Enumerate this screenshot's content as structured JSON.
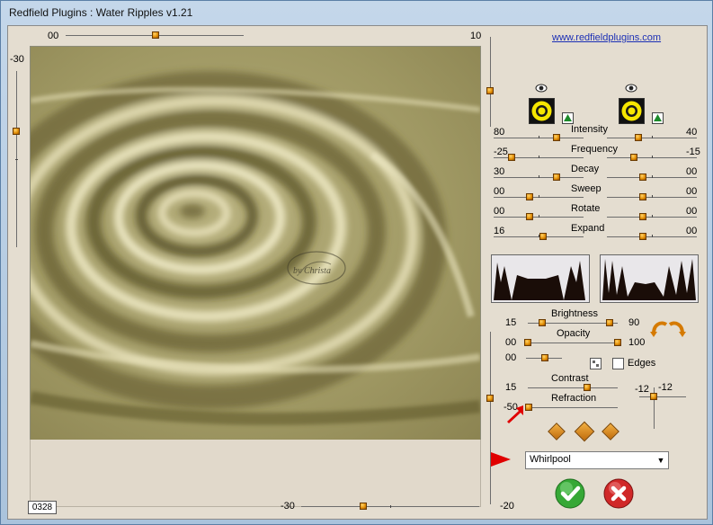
{
  "window": {
    "title": "Redfield Plugins : Water Ripples v1.21"
  },
  "link": {
    "text": "www.redfieldplugins.com"
  },
  "top_slider": {
    "min": "00",
    "max": "10",
    "value_fraction": 0.5
  },
  "left_slider": {
    "label": "-30",
    "value_fraction": 0.3
  },
  "bottom_slider": {
    "label": "-30",
    "value_fraction": 0.68
  },
  "right_vslider": {
    "top_label": "",
    "bottom_label": "-20"
  },
  "counter": {
    "value": "0328"
  },
  "preview": {
    "watermark": "by Christa",
    "base_color": "#9c9561"
  },
  "wave_params": [
    {
      "label": "Intensity",
      "left_value": "80",
      "right_value": "40",
      "left_fraction": 0.7,
      "right_fraction": 0.35
    },
    {
      "label": "Frequency",
      "left_value": "-25",
      "right_value": "-15",
      "left_fraction": 0.2,
      "right_fraction": 0.3
    },
    {
      "label": "Decay",
      "left_value": "30",
      "right_value": "00",
      "left_fraction": 0.7,
      "right_fraction": 0.4
    },
    {
      "label": "Sweep",
      "left_value": "00",
      "right_value": "00",
      "left_fraction": 0.4,
      "right_fraction": 0.4
    },
    {
      "label": "Rotate",
      "left_value": "00",
      "right_value": "00",
      "left_fraction": 0.4,
      "right_fraction": 0.4
    },
    {
      "label": "Expand",
      "left_value": "16",
      "right_value": "00",
      "left_fraction": 0.55,
      "right_fraction": 0.4
    }
  ],
  "light": {
    "brightness": {
      "label": "Brightness",
      "left_value": "15",
      "right_value": "90"
    },
    "opacity": {
      "label": "Opacity",
      "left_value": "00",
      "right_value": "100"
    },
    "third": {
      "left_value": "00"
    },
    "edges_label": "Edges",
    "contrast": {
      "label": "Contrast",
      "left_value": "15"
    },
    "refraction": {
      "label": "Refraction",
      "left_value": "-50"
    },
    "light_pos": {
      "x_label": "-12",
      "y_label": "-12"
    }
  },
  "style_select": {
    "value": "Whirlpool",
    "arrow": "▼"
  },
  "buttons": {
    "ok_icon": "check-icon",
    "cancel_icon": "x-icon"
  },
  "colors": {
    "accent": "#e08a00",
    "ok_green": "#2f9a2f",
    "cancel_red": "#c72020",
    "arrow_red": "#e00000"
  }
}
